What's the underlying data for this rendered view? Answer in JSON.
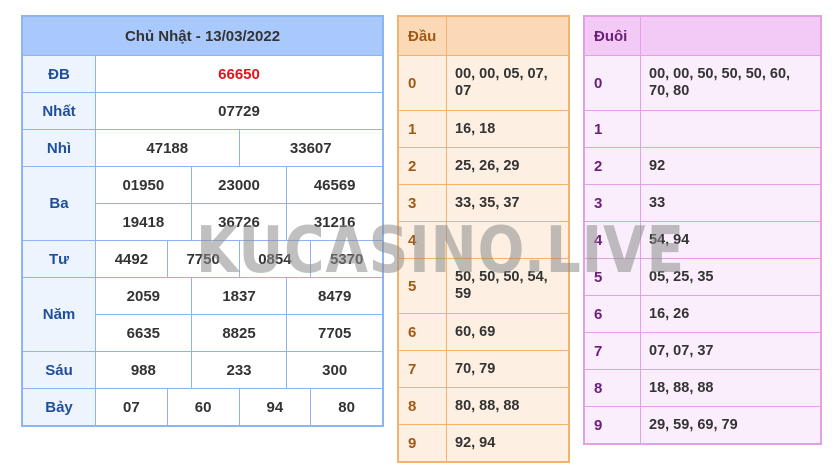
{
  "results": {
    "title": "Chủ Nhật - 13/03/2022",
    "rows": [
      {
        "label": "ĐB",
        "lines": [
          [
            "66650"
          ]
        ]
      },
      {
        "label": "Nhất",
        "lines": [
          [
            "07729"
          ]
        ]
      },
      {
        "label": "Nhì",
        "lines": [
          [
            "47188",
            "33607"
          ]
        ]
      },
      {
        "label": "Ba",
        "lines": [
          [
            "01950",
            "23000",
            "46569"
          ],
          [
            "19418",
            "36726",
            "31216"
          ]
        ]
      },
      {
        "label": "Tư",
        "lines": [
          [
            "4492",
            "7750",
            "0854",
            "5370"
          ]
        ]
      },
      {
        "label": "Năm",
        "lines": [
          [
            "2059",
            "1837",
            "8479"
          ],
          [
            "6635",
            "8825",
            "7705"
          ]
        ]
      },
      {
        "label": "Sáu",
        "lines": [
          [
            "988",
            "233",
            "300"
          ]
        ]
      },
      {
        "label": "Bảy",
        "lines": [
          [
            "07",
            "60",
            "94",
            "80"
          ]
        ]
      }
    ],
    "special_color": "#e0151b"
  },
  "dau": {
    "header": "Đầu",
    "rows": [
      {
        "k": "0",
        "v": "00, 00, 05, 07, 07"
      },
      {
        "k": "1",
        "v": "16, 18"
      },
      {
        "k": "2",
        "v": "25, 26, 29"
      },
      {
        "k": "3",
        "v": "33, 35, 37"
      },
      {
        "k": "4",
        "v": ""
      },
      {
        "k": "5",
        "v": "50, 50, 50, 54, 59"
      },
      {
        "k": "6",
        "v": "60, 69"
      },
      {
        "k": "7",
        "v": "70, 79"
      },
      {
        "k": "8",
        "v": "80, 88, 88"
      },
      {
        "k": "9",
        "v": "92, 94"
      }
    ]
  },
  "duoi": {
    "header": "Đuôi",
    "rows": [
      {
        "k": "0",
        "v": "00, 00, 50, 50, 50, 60, 70, 80"
      },
      {
        "k": "1",
        "v": ""
      },
      {
        "k": "2",
        "v": "92"
      },
      {
        "k": "3",
        "v": "33"
      },
      {
        "k": "4",
        "v": "54, 94"
      },
      {
        "k": "5",
        "v": "05, 25, 35"
      },
      {
        "k": "6",
        "v": "16, 26"
      },
      {
        "k": "7",
        "v": "07, 07, 37"
      },
      {
        "k": "8",
        "v": "18, 88, 88"
      },
      {
        "k": "9",
        "v": "29, 59, 69, 79"
      }
    ]
  },
  "watermark": "KUCASINO.LIVE"
}
